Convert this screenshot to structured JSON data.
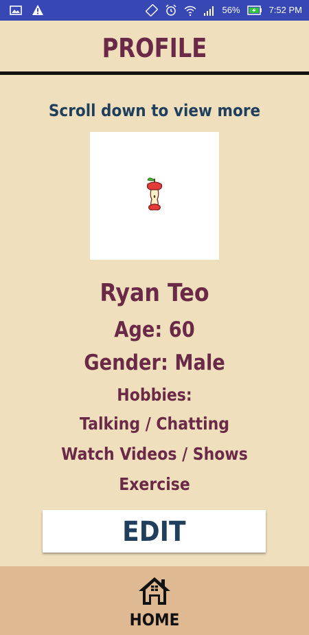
{
  "status_bar": {
    "battery": "56%",
    "time": "7:52 PM"
  },
  "header": {
    "title": "PROFILE"
  },
  "hint": "Scroll down to view more",
  "profile": {
    "name": "Ryan Teo",
    "age": "Age: 60",
    "gender": "Gender: Male",
    "hobbies_label": "Hobbies:",
    "hobbies": [
      "Talking / Chatting",
      "Watch Videos / Shows",
      "Exercise"
    ]
  },
  "edit_label": "EDIT",
  "nav": {
    "home_label": "HOME"
  },
  "icons": {
    "status_left": [
      "gallery-icon",
      "warning-icon"
    ],
    "status_right": [
      "screen-rotate-icon",
      "alarm-icon",
      "wifi-icon",
      "signal-icon",
      "battery-icon"
    ],
    "photo": "apple-core-icon",
    "nav_home": "home-icon"
  },
  "colors": {
    "status_bar": "#3748b4",
    "background": "#efdfbd",
    "title": "#6a2946",
    "hint": "#1f3f5c",
    "nav": "#dfb991"
  }
}
